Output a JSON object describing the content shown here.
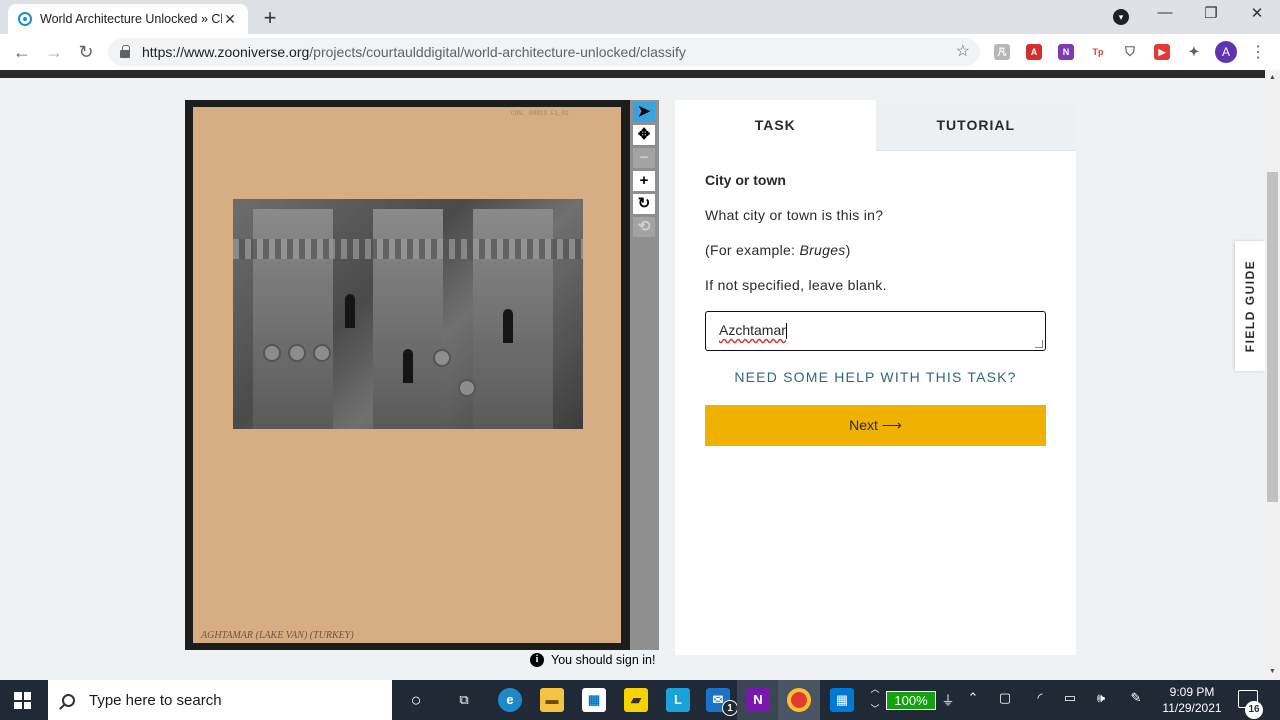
{
  "browser": {
    "tab_title": "World Architecture Unlocked » Cl",
    "url_host": "https://www.zooniverse.org",
    "url_path": "/projects/courtaulddigital/world-architecture-unlocked/classify",
    "profile_initial": "A"
  },
  "subject": {
    "stamp": "CON. 00819 F1_01",
    "caption": "AGHTAMAR   (LAKE VAN)   (TURKEY)"
  },
  "sign_in_notice": "You should sign in!",
  "panel": {
    "tabs": [
      "TASK",
      "TUTORIAL"
    ],
    "question_title": "City or town",
    "question_text": "What city or town is this in?",
    "example_prefix": "(For example: ",
    "example_value": "Bruges",
    "example_suffix": ")",
    "blank_note": "If not specified, leave blank.",
    "answer_value": "Azchtamar",
    "help_link": "NEED SOME HELP WITH THIS TASK?",
    "next_label": "Next ⟶"
  },
  "field_guide_label": "FIELD GUIDE",
  "taskbar": {
    "search_placeholder": "Type here to search",
    "battery": "100%",
    "time": "9:09 PM",
    "date": "11/29/2021",
    "notification_count": "16",
    "mail_badge": "1"
  },
  "colors": {
    "accent_next": "#f0b200",
    "help_link": "#2c6a7a",
    "active_tool": "#39a3e0"
  }
}
